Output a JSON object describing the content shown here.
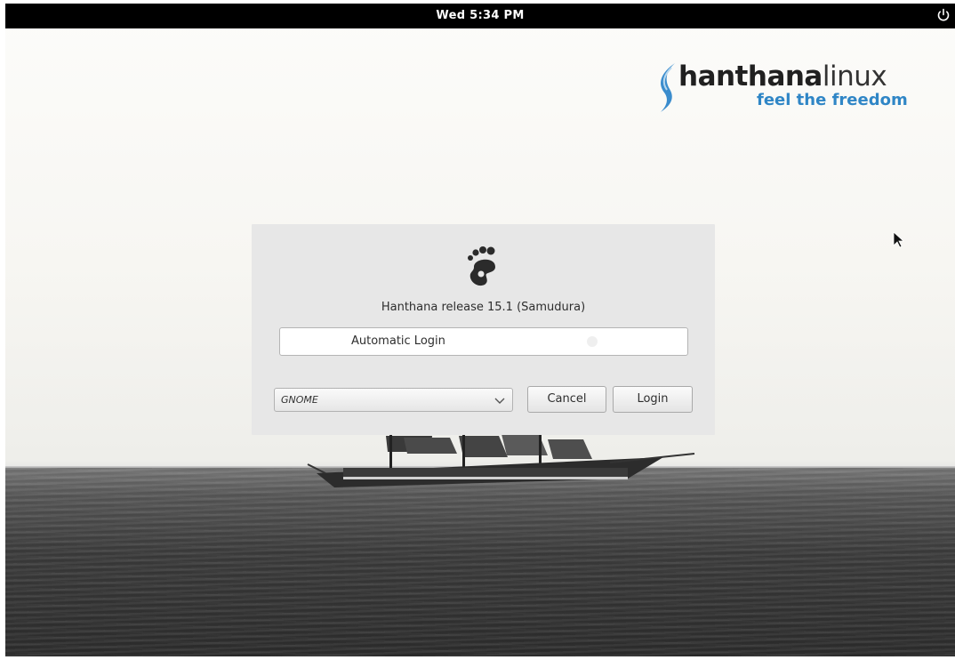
{
  "topbar": {
    "clock": "Wed  5:34 PM",
    "power_icon": "power-icon"
  },
  "logo": {
    "name_bold": "hanthana",
    "name_thin": "linux",
    "tagline": "feel the freedom",
    "colors": {
      "accent": "#2f86c6",
      "dark": "#202020"
    }
  },
  "login": {
    "icon": "gnome-foot-icon",
    "release_text": "Hanthana release 15.1 (Samudura)",
    "user_label": "Automatic Login",
    "session": {
      "selected": "GNOME",
      "icon": "chevron-down-icon"
    },
    "cancel_label": "Cancel",
    "login_label": "Login"
  }
}
